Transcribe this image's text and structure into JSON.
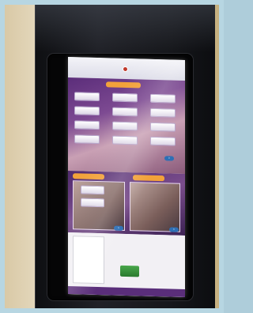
{
  "scene": {
    "subject": "kiosk-display",
    "colors": {
      "frame": "#b7d6e2",
      "kiosk_body": "#16171b",
      "screen_accent_purple": "#5b2d7a",
      "screen_accent_orange": "#f2a23a",
      "screen_button": "#ffffff"
    }
  },
  "screen": {
    "logo_icon": "logo-circle-icon",
    "header_text": "",
    "sections": [
      {
        "banner": ""
      },
      {
        "banner": ""
      },
      {
        "banner": ""
      }
    ]
  }
}
